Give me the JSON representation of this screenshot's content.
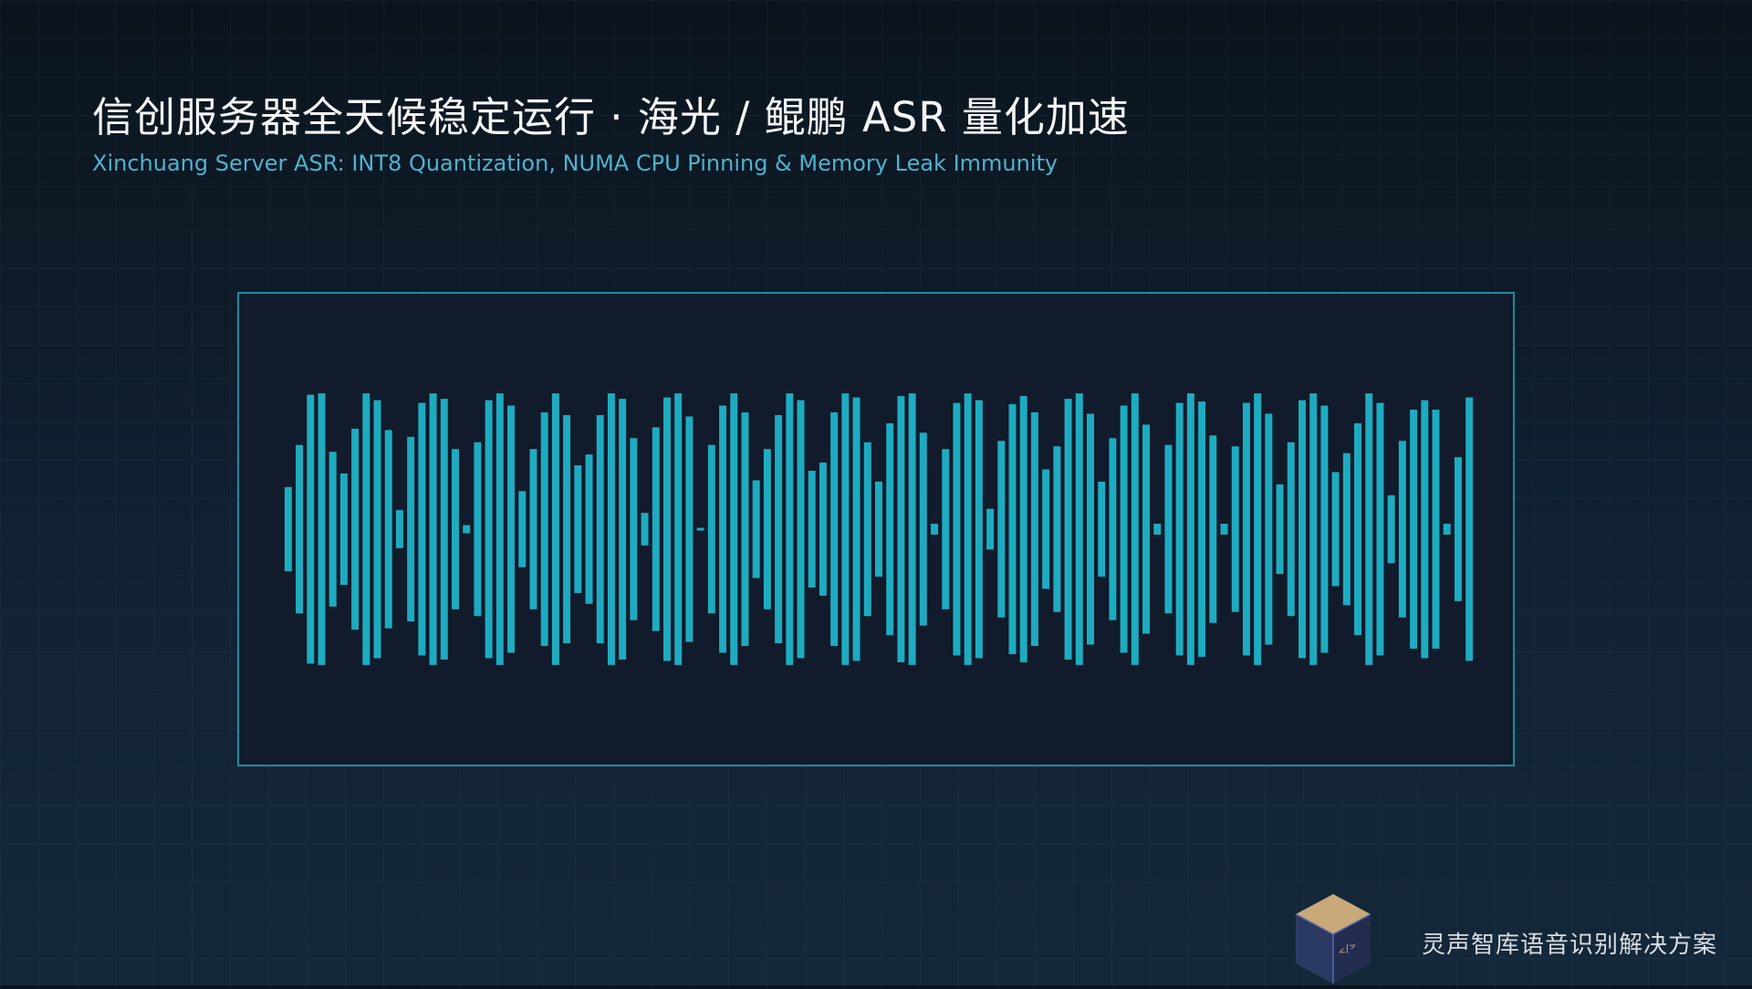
{
  "slide": {
    "title": "信创服务器全天候稳定运行 · 海光 / 鲲鹏 ASR 量化加速",
    "subtitle": "Xinchuang Server ASR: INT8 Quantization, NUMA CPU Pinning & Memory Leak Immunity"
  },
  "waveform": {
    "color": "#1eabc0",
    "levels": [
      0.31,
      0.62,
      0.99,
      1.0,
      0.57,
      0.41,
      0.74,
      1.0,
      0.95,
      0.73,
      0.14,
      0.68,
      0.93,
      1.0,
      0.96,
      0.59,
      0.03,
      0.64,
      0.95,
      1.0,
      0.91,
      0.28,
      0.59,
      0.86,
      1.0,
      0.84,
      0.47,
      0.55,
      0.84,
      1.0,
      0.96,
      0.67,
      0.12,
      0.75,
      0.97,
      1.0,
      0.83,
      0.01,
      0.62,
      0.91,
      1.0,
      0.86,
      0.36,
      0.59,
      0.84,
      1.0,
      0.95,
      0.43,
      0.49,
      0.86,
      1.0,
      0.97,
      0.64,
      0.35,
      0.78,
      0.98,
      1.0,
      0.71,
      0.04,
      0.59,
      0.93,
      1.0,
      0.95,
      0.15,
      0.65,
      0.92,
      0.98,
      0.86,
      0.44,
      0.61,
      0.96,
      1.0,
      0.85,
      0.35,
      0.67,
      0.91,
      1.0,
      0.77,
      0.04,
      0.62,
      0.93,
      1.0,
      0.94,
      0.69,
      0.04,
      0.61,
      0.93,
      1.0,
      0.85,
      0.33,
      0.64,
      0.95,
      1.0,
      0.91,
      0.42,
      0.56,
      0.78,
      1.0,
      0.93,
      0.25,
      0.65,
      0.88,
      0.95,
      0.88,
      0.04,
      0.53,
      0.97
    ]
  },
  "footer": {
    "brand": "灵声智库语音识别解决方案",
    "logo_icon": "code-cube-icon",
    "logo_glyph": "</>",
    "logo_colors": {
      "top": "#c9a97a",
      "left": "#2b3a63",
      "right": "#222d50",
      "edge": "#5b6aa8"
    }
  }
}
